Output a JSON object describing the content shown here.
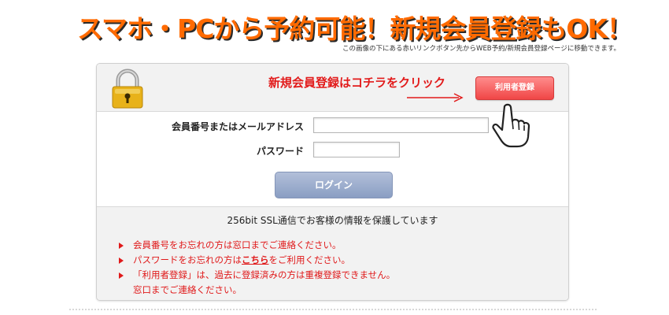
{
  "header": {
    "headline": "スマホ・PCから予約可能！新規会員登録もOK！",
    "subnote": "この画像の下にある赤いリンクボタン先からWEB予約/新規会員登録ページに移動できます。"
  },
  "panel": {
    "promo_text": "新規会員登録はコチラをクリック",
    "register_button": "利用者登録",
    "member_label": "会員番号またはメールアドレス",
    "member_value": "",
    "password_label": "パスワード",
    "password_value": "",
    "login_button": "ログイン",
    "ssl_text": "256bit SSL通信でお客様の情報を保護しています",
    "notes": {
      "n1": "会員番号をお忘れの方は窓口までご連絡ください。",
      "n2_prefix": "パスワードをお忘れの方は",
      "n2_link": "こちら",
      "n2_suffix": "をご利用ください。",
      "n3_line1": "「利用者登録」は、過去に登録済みの方は重複登録できません。",
      "n3_line2": "窓口までご連絡ください。"
    }
  },
  "colors": {
    "headline": "#ff6a00",
    "accent_red": "#e0191a",
    "register_button": "#f04646",
    "login_button": "#8a9ec3",
    "panel_header_bg": "#f2f2f2"
  },
  "icons": [
    "lock-icon",
    "arrow-right-icon",
    "pointing-hand-icon",
    "bullet-triangle-icon"
  ]
}
